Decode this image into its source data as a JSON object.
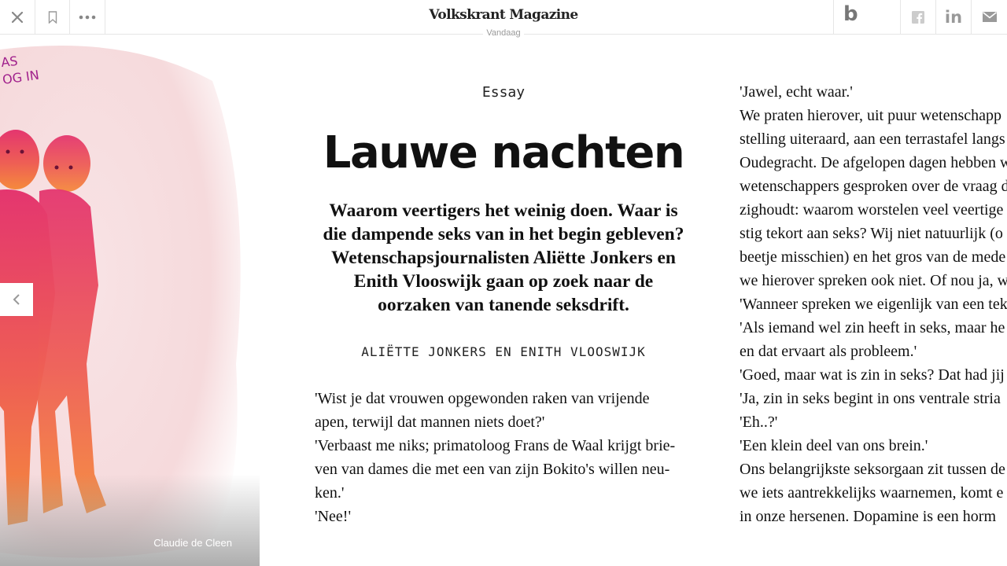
{
  "topbar": {
    "brand": "Volkskrant Magazine",
    "date": "Vandaag",
    "close_icon": "close-icon",
    "bookmark_icon": "bookmark-icon",
    "more_icon": "more-dots-icon",
    "blendle_label": "b",
    "facebook_icon": "facebook-icon",
    "linkedin_label": "in",
    "mail_icon": "mail-icon"
  },
  "illustration": {
    "caption": "Claudie de Cleen",
    "handwriting": [
      "AS",
      "OG IN"
    ],
    "colors": {
      "pink": "#e8407a",
      "orange": "#f07a3a",
      "wash": "#f6d9dc"
    }
  },
  "article": {
    "kicker": "Essay",
    "title": "Lauwe nachten",
    "lead_lines": [
      "Waarom veertigers het weinig doen. Waar is",
      "die dampende seks van in het begin gebleven?",
      "Wetenschapsjournalisten Aliëtte Jonkers en",
      "Enith Vlooswijk gaan op zoek naar de",
      "oorzaken van tanende seksdrift."
    ],
    "byline": "ALIËTTE JONKERS EN ENITH VLOOSWIJK",
    "body_lines": [
      "'Wist je dat vrouwen opgewonden raken van vrijende",
      "apen, terwijl dat mannen niets doet?'",
      "'Verbaast me niks; primatoloog Frans de Waal krijgt brie-",
      "ven van dames die met een van zijn Bokito's willen neu-",
      "ken.'",
      "'Nee!'"
    ],
    "right_lines": [
      "'Jawel, echt waar.'",
      "We praten hierover, uit puur wetenschapp",
      "stelling uiteraard, aan een terrastafel langs",
      "Oudegracht. De afgelopen dagen hebben w",
      "wetenschappers gesproken over de vraag d",
      "zighoudt: waarom worstelen veel veertige",
      "stig tekort aan seks? Wij niet natuurlijk (o",
      "beetje misschien) en het gros van de mede",
      "we hierover spreken ook niet. Of nou ja, w",
      "'Wanneer spreken we eigenlijk van een tek",
      "'Als iemand wel zin heeft in seks, maar he",
      "en dat ervaart als probleem.'",
      "'Goed, maar wat is zin in seks? Dat had jij",
      "'Ja, zin in seks begint in ons ventrale stria",
      "'Eh..?'",
      "'Een klein deel van ons brein.'",
      "Ons belangrijkste seksorgaan zit tussen de",
      "we iets aantrekkelijks waarnemen, komt e",
      "in onze hersenen. Dopamine is een horm"
    ]
  }
}
